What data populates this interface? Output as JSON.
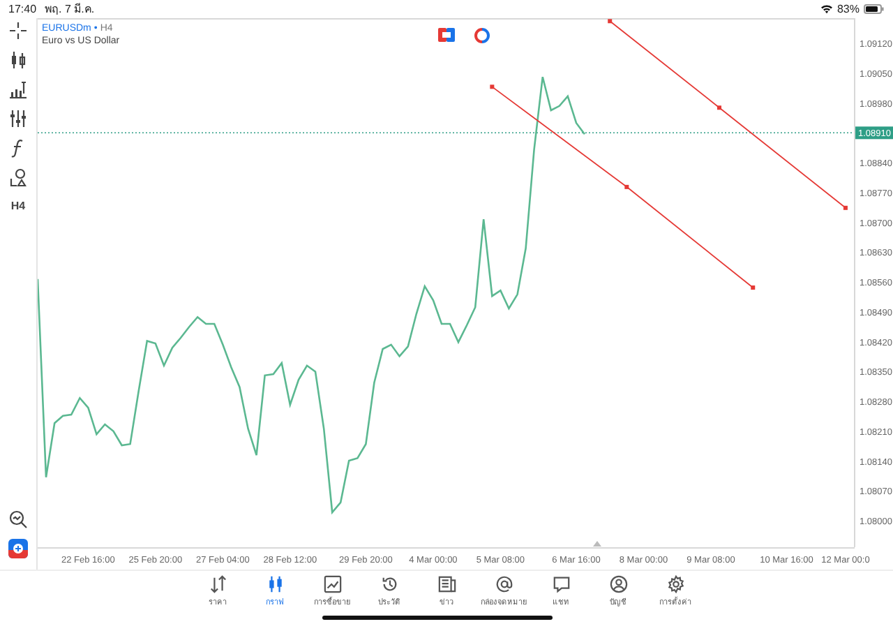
{
  "status_bar": {
    "time": "17:40",
    "date": "พฤ. 7 มี.ค.",
    "battery": "83%"
  },
  "toolbar": {
    "timeframe": "H4"
  },
  "chart": {
    "symbol": "EURUSDm",
    "separator": "•",
    "timeframe": "H4",
    "description": "Euro vs US Dollar",
    "chart_data": {
      "type": "line",
      "categories": [
        null,
        null,
        null,
        null,
        null,
        null,
        "22 Feb 16:00",
        null,
        null,
        null,
        null,
        null,
        null,
        null,
        "25 Feb 20:00",
        null,
        null,
        null,
        null,
        null,
        null,
        null,
        "27 Feb 04:00",
        null,
        null,
        null,
        null,
        null,
        null,
        null,
        "28 Feb 12:00",
        null,
        null,
        null,
        null,
        null,
        null,
        null,
        null,
        "29 Feb 20:00",
        null,
        null,
        null,
        null,
        null,
        null,
        null,
        "4 Mar 00:00",
        null,
        null,
        null,
        null,
        null,
        null,
        null,
        "5 Mar 08:00",
        null,
        null,
        null,
        null,
        null,
        null,
        null,
        null,
        "6 Mar 16:00",
        null,
        null,
        null,
        null,
        null,
        null,
        null,
        "8 Mar 00:00",
        null,
        null,
        null,
        null,
        null,
        null,
        null,
        "9 Mar 08:00",
        null,
        null,
        null,
        null,
        null,
        null,
        null,
        null,
        "10 Mar 16:00",
        null,
        null,
        null,
        null,
        null,
        null,
        "12 Mar 00:0"
      ],
      "series": [
        {
          "color": "#5bb891",
          "values": [
            1.08567,
            1.08102,
            1.08229,
            1.08246,
            1.08249,
            1.08288,
            1.08265,
            1.08203,
            1.08226,
            1.0821,
            1.08177,
            1.0818,
            1.08305,
            1.08422,
            1.08416,
            1.08364,
            1.08406,
            1.08429,
            1.08455,
            1.08478,
            1.08462,
            1.08462,
            1.08413,
            1.0836,
            1.08314,
            1.08216,
            1.08154,
            1.08341,
            1.08344,
            1.0837,
            1.08272,
            1.08331,
            1.08364,
            1.0835,
            1.08216,
            1.0802,
            1.08043,
            1.08141,
            1.08147,
            1.0818,
            1.08324,
            1.08403,
            1.08413,
            1.08386,
            1.08409,
            1.08485,
            1.0855,
            1.08517,
            1.08462,
            1.08462,
            1.08419,
            1.08459,
            1.08501,
            1.08707,
            1.08527,
            1.0854,
            1.08498,
            1.08531,
            1.08639,
            1.08871,
            1.09041,
            1.08963,
            1.08973,
            1.08996,
            1.08933,
            1.08907,
            null,
            null,
            null,
            null,
            null,
            null,
            null,
            null,
            null,
            null,
            null,
            null,
            null,
            null,
            null,
            null,
            null,
            null,
            null,
            null,
            null,
            null,
            null,
            null,
            null,
            null,
            null,
            null,
            null,
            null,
            null
          ]
        },
        {
          "marker": true,
          "color": "#e53935",
          "values": [
            null,
            null,
            null,
            null,
            null,
            null,
            null,
            null,
            null,
            null,
            null,
            null,
            null,
            null,
            null,
            null,
            null,
            null,
            null,
            null,
            null,
            null,
            null,
            null,
            null,
            null,
            null,
            null,
            null,
            null,
            null,
            null,
            null,
            null,
            null,
            null,
            null,
            null,
            null,
            null,
            null,
            null,
            null,
            null,
            null,
            null,
            null,
            null,
            null,
            null,
            null,
            null,
            null,
            null,
            1.09018,
            null,
            null,
            null,
            null,
            null,
            null,
            null,
            null,
            null,
            null,
            null,
            null,
            null,
            null,
            null,
            1.08783,
            null,
            null,
            null,
            null,
            null,
            null,
            null,
            null,
            null,
            null,
            null,
            null,
            null,
            null,
            1.08547,
            null,
            null,
            null,
            null,
            null,
            null,
            null,
            null,
            null,
            null,
            null
          ]
        },
        {
          "marker": true,
          "color": "#e53935",
          "values": [
            null,
            null,
            null,
            null,
            null,
            null,
            null,
            null,
            null,
            null,
            null,
            null,
            null,
            null,
            null,
            null,
            null,
            null,
            null,
            null,
            null,
            null,
            null,
            null,
            null,
            null,
            null,
            null,
            null,
            null,
            null,
            null,
            null,
            null,
            null,
            null,
            null,
            null,
            null,
            null,
            null,
            null,
            null,
            null,
            null,
            null,
            null,
            null,
            null,
            null,
            null,
            null,
            null,
            null,
            null,
            null,
            null,
            null,
            null,
            null,
            null,
            null,
            null,
            null,
            null,
            null,
            null,
            null,
            1.09172,
            null,
            null,
            null,
            null,
            null,
            null,
            null,
            null,
            null,
            null,
            null,
            null,
            1.08969,
            null,
            null,
            null,
            null,
            null,
            null,
            null,
            null,
            null,
            null,
            null,
            null,
            null,
            null,
            1.08734
          ]
        }
      ],
      "ref_lines": [
        {
          "axis": "y",
          "value": 1.0891,
          "label": "1.08910",
          "color": "#2e9e86"
        }
      ],
      "ylim": [
        1.07938,
        1.09179
      ],
      "yticks": [
        {
          "value": 1.0912,
          "label": "1.09120"
        },
        {
          "value": 1.0905,
          "label": "1.09050"
        },
        {
          "value": 1.0898,
          "label": "1.08980"
        },
        {
          "value": 1.0884,
          "label": "1.08840"
        },
        {
          "value": 1.0877,
          "label": "1.08770"
        },
        {
          "value": 1.087,
          "label": "1.08700"
        },
        {
          "value": 1.0863,
          "label": "1.08630"
        },
        {
          "value": 1.0856,
          "label": "1.08560"
        },
        {
          "value": 1.0849,
          "label": "1.08490"
        },
        {
          "value": 1.0842,
          "label": "1.08420"
        },
        {
          "value": 1.0835,
          "label": "1.08350"
        },
        {
          "value": 1.0828,
          "label": "1.08280"
        },
        {
          "value": 1.0821,
          "label": "1.08210"
        },
        {
          "value": 1.0814,
          "label": "1.08140"
        },
        {
          "value": 1.0807,
          "label": "1.08070"
        },
        {
          "value": 1.08,
          "label": "1.08000"
        }
      ]
    }
  },
  "tabs": [
    {
      "label": "ราคา",
      "selected": false
    },
    {
      "label": "กราฟ",
      "selected": true
    },
    {
      "label": "การซื้อขาย",
      "selected": false
    },
    {
      "label": "ประวัติ",
      "selected": false
    },
    {
      "label": "ข่าว",
      "selected": false
    },
    {
      "label": "กล่องจดหมาย",
      "selected": false
    },
    {
      "label": "แชท",
      "selected": false
    },
    {
      "label": "บัญชี",
      "selected": false
    },
    {
      "label": "การตั้งค่า",
      "selected": false
    }
  ]
}
